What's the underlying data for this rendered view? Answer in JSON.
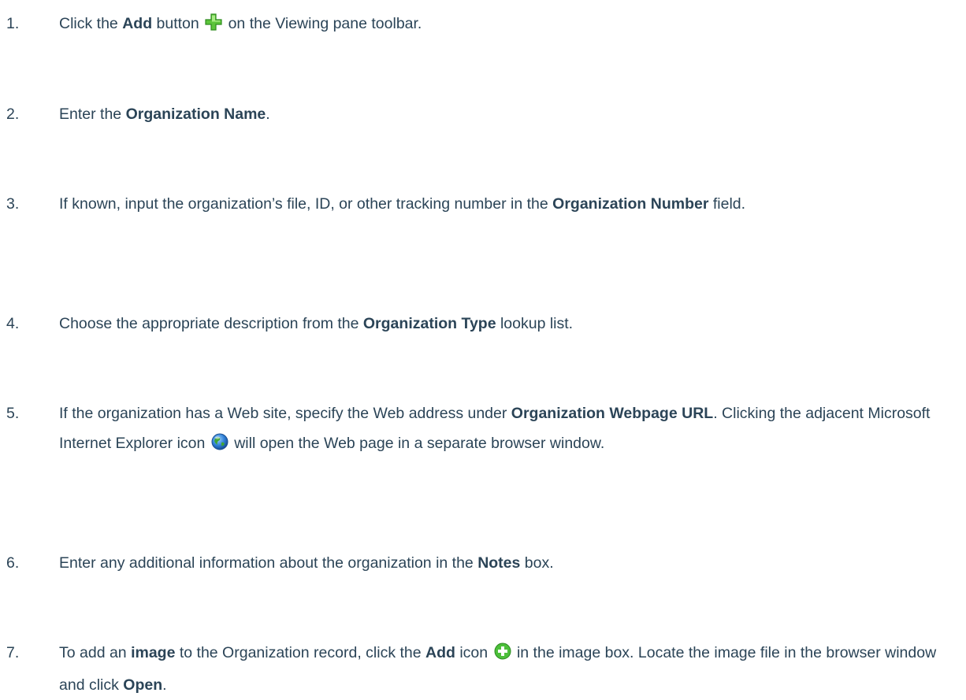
{
  "steps": [
    {
      "number": "1.",
      "before": "Click the ",
      "bold1": "Add",
      "mid": " button",
      "icon": "green-plus-icon",
      "after": " on the Viewing pane toolbar."
    },
    {
      "number": "2.",
      "before": "Enter the ",
      "bold1": "Organization Name",
      "after": "."
    },
    {
      "number": "3.",
      "before": "If known, input the organization’s file, ID, or other tracking number in the ",
      "bold1": "Organization Number",
      "after": " field."
    },
    {
      "number": "4.",
      "before": "Choose the appropriate description from the ",
      "bold1": "Organization Type",
      "after": " lookup list."
    },
    {
      "number": "5.",
      "before": "If the organization has a Web site, specify the Web address under ",
      "bold1": "Organization Webpage URL",
      "mid": ". Clicking the adjacent Microsoft Internet Explorer icon",
      "icon": "globe-icon",
      "after": " will open the Web page in a separate browser window."
    },
    {
      "number": "6.",
      "before": "Enter any additional information about the organization in the ",
      "bold1": "Notes",
      "after": " box."
    },
    {
      "number": "7.",
      "before": "To add an ",
      "bold1": "image",
      "mid": " to the Organization record, click the ",
      "bold2": "Add",
      "mid2": " icon",
      "icon": "green-circle-plus-icon",
      "after": " in the image box. Locate the image file in the browser window and click ",
      "bold3": "Open",
      "end": "."
    }
  ]
}
